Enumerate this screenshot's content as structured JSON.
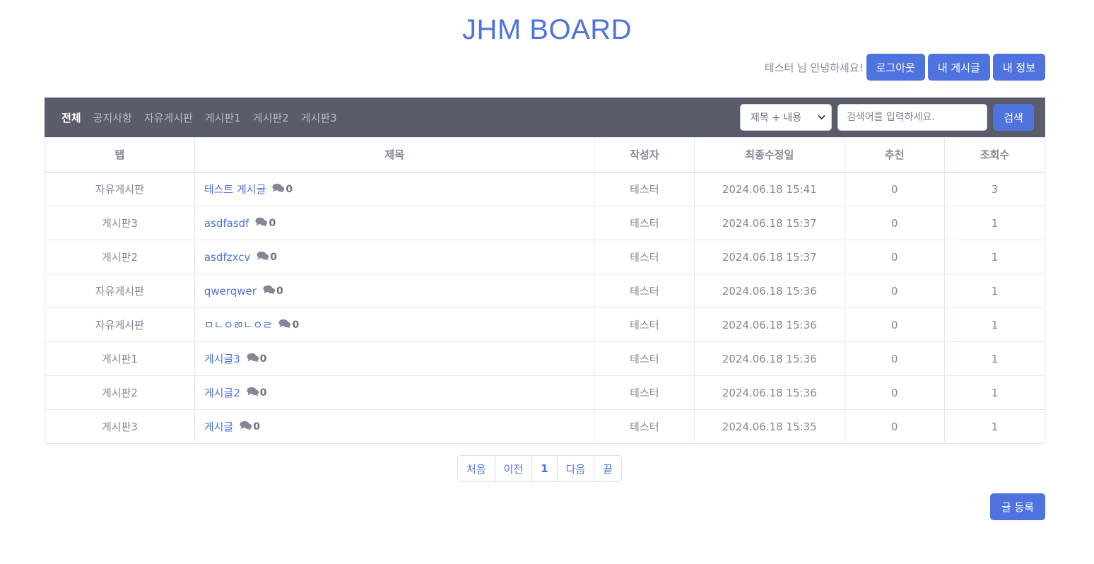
{
  "header": {
    "title": "JHM BOARD"
  },
  "user_bar": {
    "greeting": "테스터 님 안녕하세요!",
    "logout_label": "로그아웃",
    "my_posts_label": "내 게시글",
    "my_info_label": "내 정보"
  },
  "nav": {
    "tabs": [
      {
        "label": "전체",
        "active": true
      },
      {
        "label": "공지사항"
      },
      {
        "label": "자유게시판"
      },
      {
        "label": "게시판1"
      },
      {
        "label": "게시판2"
      },
      {
        "label": "게시판3"
      }
    ]
  },
  "search": {
    "selected_option": "제목 + 내용",
    "placeholder": "검색어를 입력하세요.",
    "button_label": "검색"
  },
  "table": {
    "columns": [
      "탭",
      "제목",
      "작성자",
      "최종수정일",
      "추천",
      "조회수"
    ],
    "rows": [
      {
        "tab": "자유게시판",
        "title": "테스트 게시글",
        "comments": "0",
        "author": "테스터",
        "modified": "2024.06.18 15:41",
        "likes": "0",
        "views": "3"
      },
      {
        "tab": "게시판3",
        "title": "asdfasdf",
        "comments": "0",
        "author": "테스터",
        "modified": "2024.06.18 15:37",
        "likes": "0",
        "views": "1"
      },
      {
        "tab": "게시판2",
        "title": "asdfzxcv",
        "comments": "0",
        "author": "테스터",
        "modified": "2024.06.18 15:37",
        "likes": "0",
        "views": "1"
      },
      {
        "tab": "자유게시판",
        "title": "qwerqwer",
        "comments": "0",
        "author": "테스터",
        "modified": "2024.06.18 15:36",
        "likes": "0",
        "views": "1"
      },
      {
        "tab": "자유게시판",
        "title": "ㅁㄴㅇㄻㄴㅇㄹ",
        "comments": "0",
        "author": "테스터",
        "modified": "2024.06.18 15:36",
        "likes": "0",
        "views": "1"
      },
      {
        "tab": "게시판1",
        "title": "게시글3",
        "comments": "0",
        "author": "테스터",
        "modified": "2024.06.18 15:36",
        "likes": "0",
        "views": "1"
      },
      {
        "tab": "게시판2",
        "title": "게시글2",
        "comments": "0",
        "author": "테스터",
        "modified": "2024.06.18 15:36",
        "likes": "0",
        "views": "1"
      },
      {
        "tab": "게시판3",
        "title": "게시글",
        "comments": "0",
        "author": "테스터",
        "modified": "2024.06.18 15:35",
        "likes": "0",
        "views": "1"
      }
    ]
  },
  "pagination": {
    "first_label": "처음",
    "prev_label": "이전",
    "current_page": "1",
    "next_label": "다음",
    "last_label": "끝"
  },
  "actions": {
    "write_label": "글 등록"
  },
  "icons": {
    "comment": "comments-icon",
    "select": "chevron-down-icon"
  },
  "colors": {
    "primary": "#4e73df",
    "navbar": "#5a5c69",
    "text_muted": "#858796"
  }
}
